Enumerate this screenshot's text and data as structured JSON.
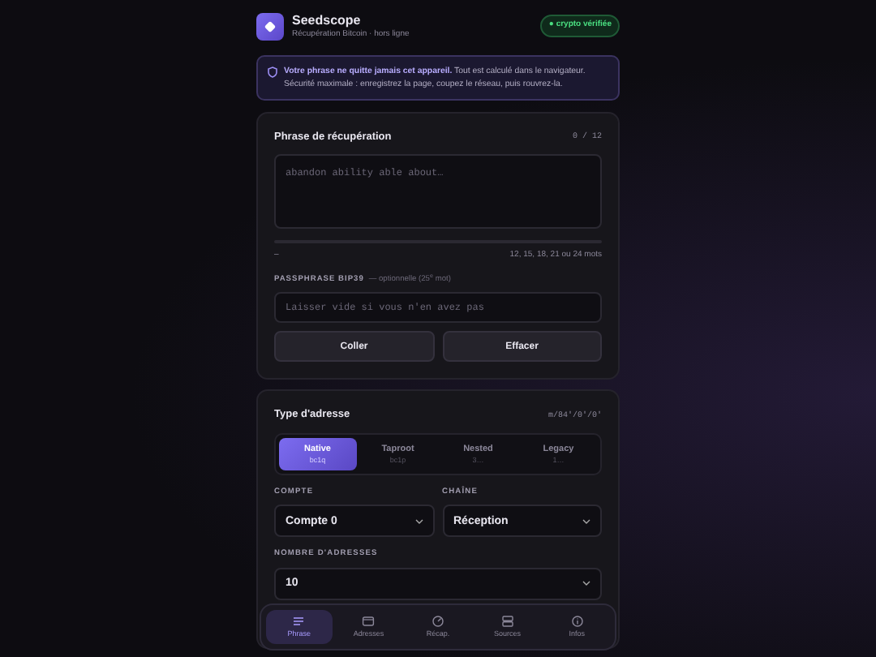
{
  "header": {
    "title": "Seedscope",
    "subtitle": "Récupération Bitcoin · hors ligne",
    "badge": "● crypto vérifiée"
  },
  "notice": {
    "text": "**Votre phrase ne quitte jamais cet appareil.** Tout est calculé dans le navigateur. Sécurité maximale : enregistrez la page, coupez le réseau, puis rouvrez-la."
  },
  "phrase_card": {
    "title": "Phrase de récupération",
    "counter": "0 / 12",
    "placeholder": "abandon ability able about…",
    "status": "–",
    "hint": "12, 15, 18, 21 ou 24 mots",
    "passphrase_label": "PASSPHRASE BIP39",
    "passphrase_note": "— optionnelle (25$^{e}$ mot)",
    "passphrase_placeholder": "Laisser vide si vous n'en avez pas",
    "buttons": [
      "Coller",
      "Effacer"
    ]
  },
  "address_card": {
    "title": "Type d'adresse",
    "path": "m/84'/0'/0'",
    "tabs": [
      {
        "label": "Native",
        "prefix": "bc1q",
        "selected": true
      },
      {
        "label": "Taproot",
        "prefix": "bc1p",
        "selected": false
      },
      {
        "label": "Nested",
        "prefix": "3…",
        "selected": false
      },
      {
        "label": "Legacy",
        "prefix": "1…",
        "selected": false
      }
    ],
    "account_label": "COMPTE",
    "account_value": "Compte 0",
    "chain_label": "CHAÎNE",
    "chain_value": "Réception",
    "count_label": "NOMBRE D'ADRESSES",
    "count_value": "10"
  },
  "bottom_nav": [
    {
      "label": "Phrase",
      "selected": true
    },
    {
      "label": "Adresses",
      "selected": false
    },
    {
      "label": "Récap.",
      "selected": false
    },
    {
      "label": "Sources",
      "selected": false
    },
    {
      "label": "Infos",
      "selected": false
    }
  ]
}
